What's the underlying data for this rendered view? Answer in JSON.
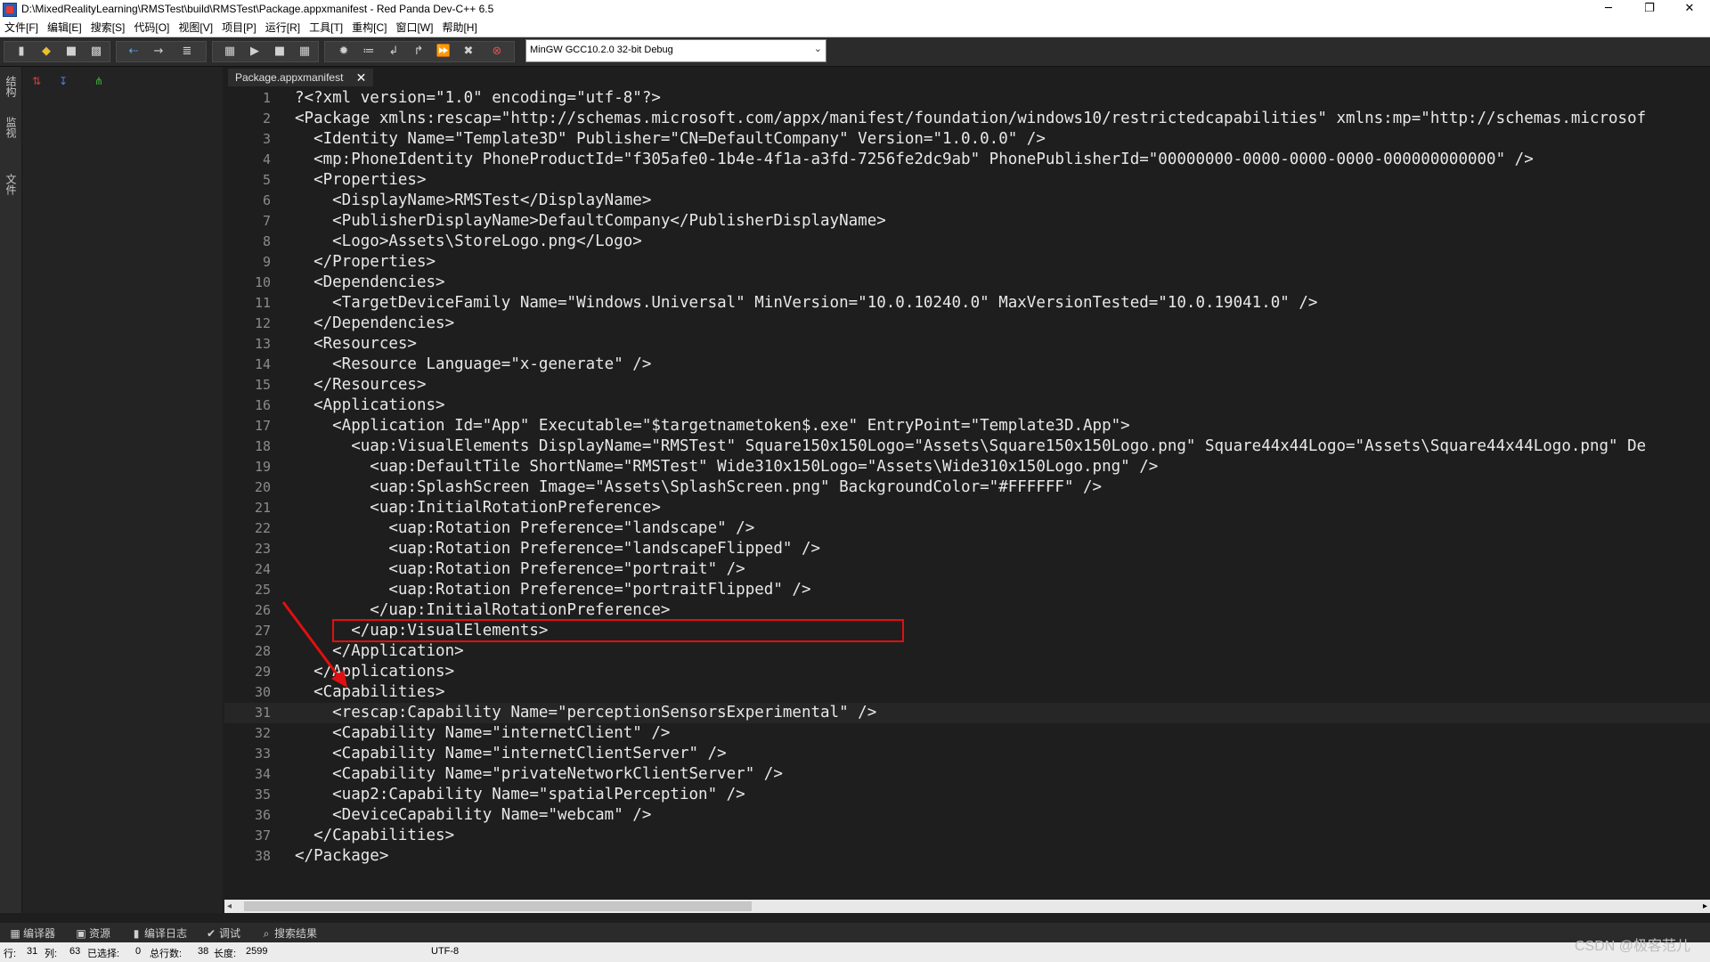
{
  "window": {
    "title": "D:\\MixedRealityLearning\\RMSTest\\build\\RMSTest\\Package.appxmanifest - Red Panda Dev-C++ 6.5",
    "minimize": "─",
    "maximize": "❐",
    "close": "✕"
  },
  "menu": [
    "文件[F]",
    "编辑[E]",
    "搜索[S]",
    "代码[O]",
    "视图[V]",
    "项目[P]",
    "运行[R]",
    "工具[T]",
    "重构[C]",
    "窗口[W]",
    "帮助[H]"
  ],
  "toolbar": {
    "compiler": "MinGW GCC10.2.0 32-bit Debug",
    "icons": [
      "new-file-icon",
      "open-file-icon",
      "save-icon",
      "save-all-icon",
      "back-icon",
      "forward-icon",
      "format-icon",
      "compile-icon",
      "run-icon",
      "stop-icon",
      "grid-icon",
      "debug-icon",
      "step-icon",
      "step-into-icon",
      "step-out-icon",
      "continue-icon",
      "abort-icon",
      "profile-icon"
    ]
  },
  "left_strip": [
    "结构",
    "监视",
    "文件"
  ],
  "editor": {
    "tab_label": "Package.appxmanifest",
    "tab_close": "✕",
    "current_line": 31,
    "lines": [
      "?<?xml version=\"1.0\" encoding=\"utf-8\"?>",
      "<Package xmlns:rescap=\"http://schemas.microsoft.com/appx/manifest/foundation/windows10/restrictedcapabilities\" xmlns:mp=\"http://schemas.microsof",
      "  <Identity Name=\"Template3D\" Publisher=\"CN=DefaultCompany\" Version=\"1.0.0.0\" />",
      "  <mp:PhoneIdentity PhoneProductId=\"f305afe0-1b4e-4f1a-a3fd-7256fe2dc9ab\" PhonePublisherId=\"00000000-0000-0000-0000-000000000000\" />",
      "  <Properties>",
      "    <DisplayName>RMSTest</DisplayName>",
      "    <PublisherDisplayName>DefaultCompany</PublisherDisplayName>",
      "    <Logo>Assets\\StoreLogo.png</Logo>",
      "  </Properties>",
      "  <Dependencies>",
      "    <TargetDeviceFamily Name=\"Windows.Universal\" MinVersion=\"10.0.10240.0\" MaxVersionTested=\"10.0.19041.0\" />",
      "  </Dependencies>",
      "  <Resources>",
      "    <Resource Language=\"x-generate\" />",
      "  </Resources>",
      "  <Applications>",
      "    <Application Id=\"App\" Executable=\"$targetnametoken$.exe\" EntryPoint=\"Template3D.App\">",
      "      <uap:VisualElements DisplayName=\"RMSTest\" Square150x150Logo=\"Assets\\Square150x150Logo.png\" Square44x44Logo=\"Assets\\Square44x44Logo.png\" De",
      "        <uap:DefaultTile ShortName=\"RMSTest\" Wide310x150Logo=\"Assets\\Wide310x150Logo.png\" />",
      "        <uap:SplashScreen Image=\"Assets\\SplashScreen.png\" BackgroundColor=\"#FFFFFF\" />",
      "        <uap:InitialRotationPreference>",
      "          <uap:Rotation Preference=\"landscape\" />",
      "          <uap:Rotation Preference=\"landscapeFlipped\" />",
      "          <uap:Rotation Preference=\"portrait\" />",
      "          <uap:Rotation Preference=\"portraitFlipped\" />",
      "        </uap:InitialRotationPreference>",
      "      </uap:VisualElements>",
      "    </Application>",
      "  </Applications>",
      "  <Capabilities>",
      "    <rescap:Capability Name=\"perceptionSensorsExperimental\" />",
      "    <Capability Name=\"internetClient\" />",
      "    <Capability Name=\"internetClientServer\" />",
      "    <Capability Name=\"privateNetworkClientServer\" />",
      "    <uap2:Capability Name=\"spatialPerception\" />",
      "    <DeviceCapability Name=\"webcam\" />",
      "  </Capabilities>",
      "</Package>"
    ]
  },
  "bottom_tabs": [
    {
      "icon": "compiler-icon",
      "glyph": "▦",
      "label": "编译器"
    },
    {
      "icon": "resource-icon",
      "glyph": "▣",
      "label": "资源"
    },
    {
      "icon": "compile-log-icon",
      "glyph": "▮",
      "label": "编译日志"
    },
    {
      "icon": "debug-check-icon",
      "glyph": "✔",
      "label": "调试"
    },
    {
      "icon": "search-results-icon",
      "glyph": "⌕",
      "label": "搜索结果"
    }
  ],
  "status": {
    "row_label": "行:",
    "row": "31",
    "col_label": "列:",
    "col": "63",
    "selected_label": "已选择:",
    "selected": "0",
    "total_rows_label": "总行数:",
    "total_rows": "38",
    "length_label": "长度:",
    "length": "2599",
    "encoding": "UTF-8"
  },
  "watermark": "CSDN @极客范儿",
  "colors": {
    "editor_bg": "#1e1e1e",
    "annotation_red": "#e01010"
  }
}
